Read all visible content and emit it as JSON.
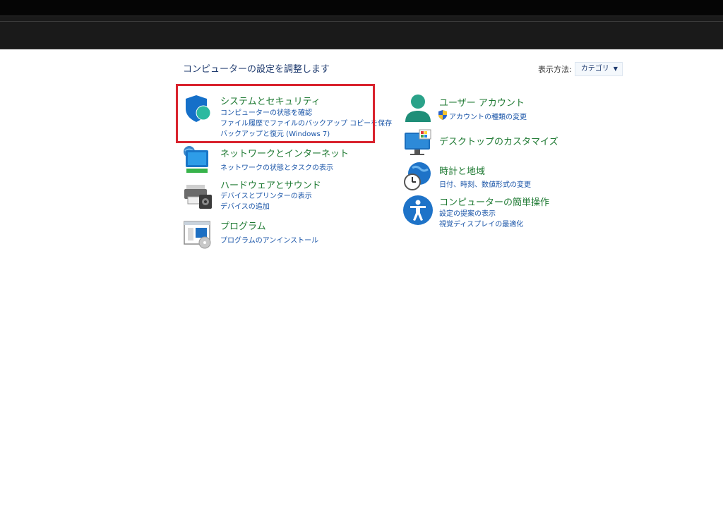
{
  "header": {
    "title": "コンピューターの設定を調整します"
  },
  "view_by": {
    "label": "表示方法:",
    "value": "カテゴリ"
  },
  "left_categories": [
    {
      "title": "システムとセキュリティ",
      "links": [
        "コンピューターの状態を確認",
        "ファイル履歴でファイルのバックアップ コピーを保存",
        "バックアップと復元 (Windows 7)"
      ]
    },
    {
      "title": "ネットワークとインターネット",
      "links": [
        "ネットワークの状態とタスクの表示"
      ]
    },
    {
      "title": "ハードウェアとサウンド",
      "links": [
        "デバイスとプリンターの表示",
        "デバイスの追加"
      ]
    },
    {
      "title": "プログラム",
      "links": [
        "プログラムのアンインストール"
      ]
    }
  ],
  "right_categories": [
    {
      "title": "ユーザー アカウント",
      "links": [
        "アカウントの種類の変更"
      ]
    },
    {
      "title": "デスクトップのカスタマイズ",
      "links": []
    },
    {
      "title": "時計と地域",
      "links": [
        "日付、時刻、数値形式の変更"
      ]
    },
    {
      "title": "コンピューターの簡単操作",
      "links": [
        "設定の提案の表示",
        "視覚ディスプレイの最適化"
      ]
    }
  ],
  "colors": {
    "category_title": "#1f7a33",
    "link": "#1a55a8",
    "highlight": "#d9232e"
  }
}
